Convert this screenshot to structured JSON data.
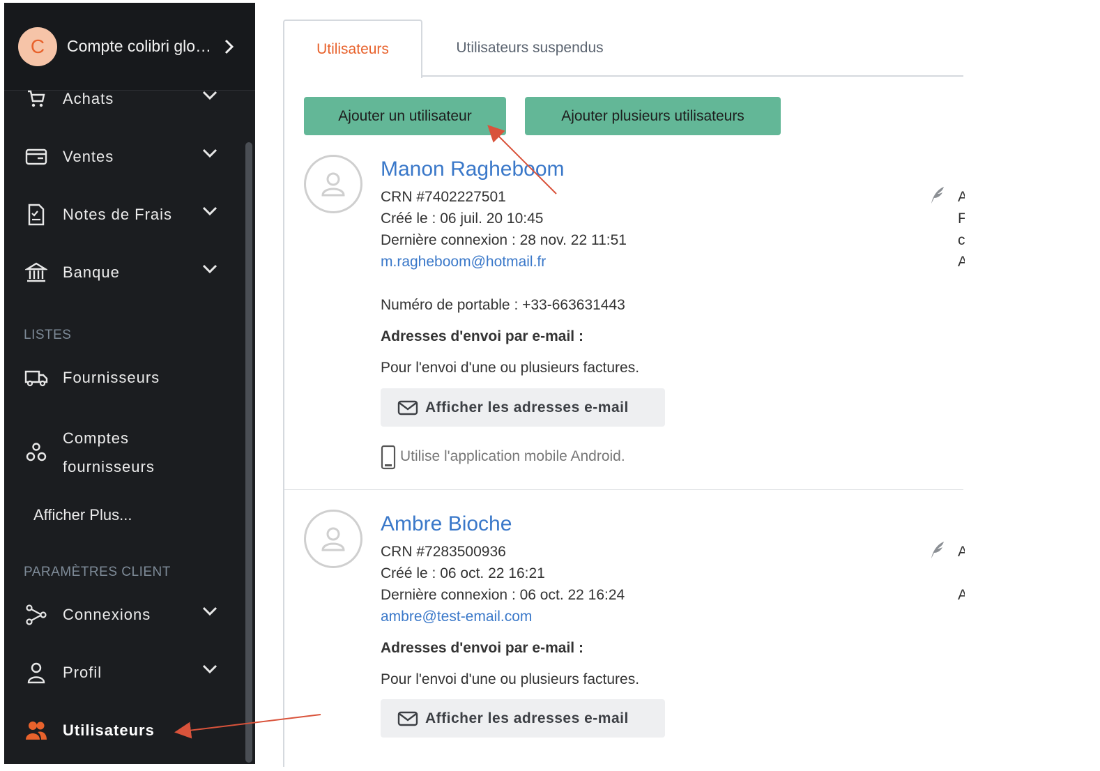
{
  "account": {
    "initial": "C",
    "name": "Compte colibri glo…"
  },
  "nav": {
    "achats": "Achats",
    "ventes": "Ventes",
    "notes_frais": "Notes de Frais",
    "banque": "Banque",
    "section_listes": "LISTES",
    "fournisseurs": "Fournisseurs",
    "comptes_fournisseurs_1": "Comptes",
    "comptes_fournisseurs_2": "fournisseurs",
    "afficher_plus": "Afficher Plus...",
    "section_parametres": "PARAMÈTRES CLIENT",
    "connexions": "Connexions",
    "profil": "Profil",
    "utilisateurs": "Utilisateurs"
  },
  "tabs": {
    "active": "Utilisateurs",
    "inactive": "Utilisateurs suspendus"
  },
  "buttons": {
    "add_user": "Ajouter un utilisateur",
    "add_many": "Ajouter plusieurs utilisateurs"
  },
  "users": [
    {
      "name": "Manon Ragheboom",
      "crn": "CRN #7402227501",
      "created": "Créé le : 06 juil. 20 10:45",
      "last_login": "Dernière connexion : 28 nov. 22 11:51",
      "email": "m.ragheboom@hotmail.fr",
      "phone": "Numéro de portable : +33-663631443",
      "send_title": "Adresses d'envoi par e-mail :",
      "send_desc": "Pour l'envoi d'une ou plusieurs factures.",
      "show_emails": "Afficher les adresses e-mail",
      "app": "Utilise l'application mobile Android.",
      "right_chars": [
        "A",
        "F",
        "c",
        "A"
      ]
    },
    {
      "name": "Ambre Bioche",
      "crn": "CRN #7283500936",
      "created": "Créé le : 06 oct. 22 16:21",
      "last_login": "Dernière connexion : 06 oct. 22 16:24",
      "email": "ambre@test-email.com",
      "send_title": "Adresses d'envoi par e-mail :",
      "send_desc": "Pour l'envoi d'une ou plusieurs factures.",
      "show_emails": "Afficher les adresses e-mail",
      "right_chars": [
        "A",
        "A"
      ]
    }
  ],
  "colors": {
    "accent": "#e8622c",
    "green": "#63b797",
    "link": "#3a78c9",
    "sidebar": "#1b1d20"
  }
}
